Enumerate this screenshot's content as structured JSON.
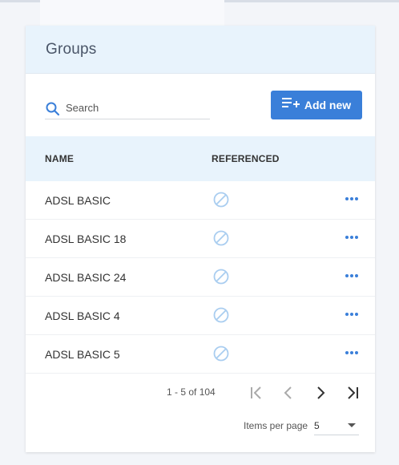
{
  "header": {
    "title": "Groups"
  },
  "search": {
    "placeholder": "Search",
    "value": ""
  },
  "add_button": {
    "label": "Add new"
  },
  "table": {
    "columns": [
      "NAME",
      "REFERENCED"
    ],
    "rows": [
      {
        "name": "ADSL BASIC",
        "referenced": "not-referenced-icon"
      },
      {
        "name": "ADSL BASIC 18",
        "referenced": "not-referenced-icon"
      },
      {
        "name": "ADSL BASIC 24",
        "referenced": "not-referenced-icon"
      },
      {
        "name": "ADSL BASIC 4",
        "referenced": "not-referenced-icon"
      },
      {
        "name": "ADSL BASIC 5",
        "referenced": "not-referenced-icon"
      }
    ]
  },
  "pagination": {
    "range_label": "1 - 5 of 104",
    "items_per_page_label": "Items per page",
    "items_per_page_value": "5"
  },
  "colors": {
    "accent": "#3a7fd9",
    "header_bg": "#e8f3fc",
    "icon_disabled": "#a9cdf0"
  }
}
